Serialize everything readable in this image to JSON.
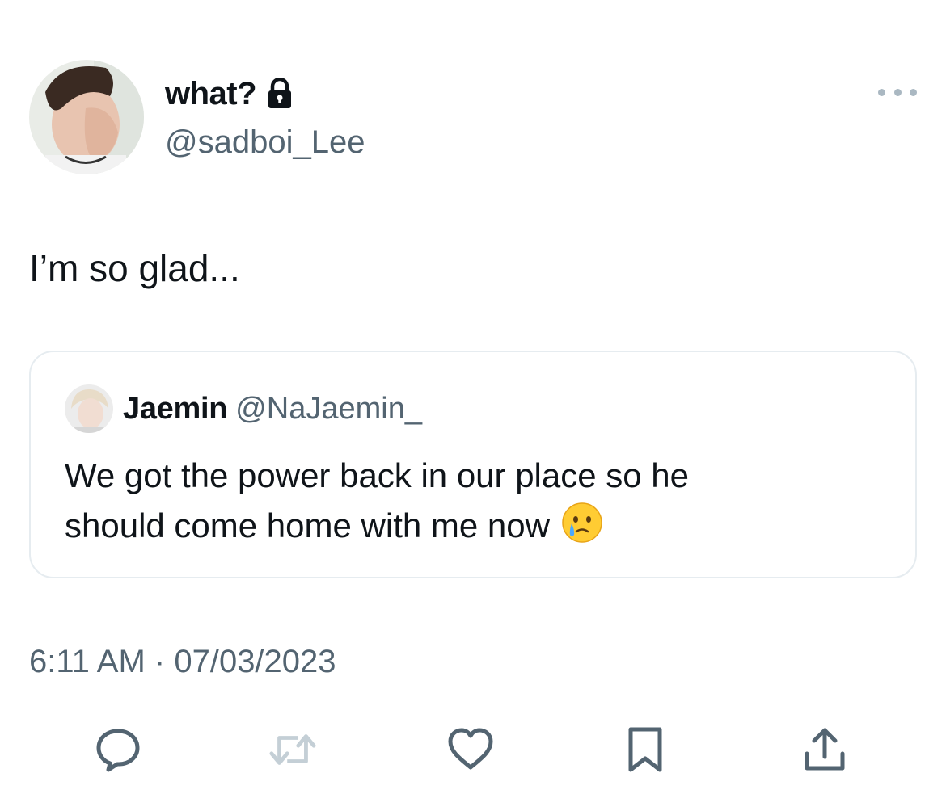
{
  "author": {
    "name": "what?",
    "handle": "@sadboi_Lee",
    "protected_icon": "lock-icon"
  },
  "tweet": {
    "text": "I’m so glad...",
    "timestamp": "6:11 AM · 07/03/2023"
  },
  "quoted_tweet": {
    "name": "Jaemin",
    "handle": "@NaJaemin_",
    "text_line1": "We got the power back in our place so he",
    "text_line2": "should come home with me now",
    "emoji": "face-holding-back-tears"
  },
  "actions": [
    {
      "name": "reply",
      "icon": "reply-icon"
    },
    {
      "name": "retweet",
      "icon": "retweet-icon"
    },
    {
      "name": "like",
      "icon": "heart-icon"
    },
    {
      "name": "bookmark",
      "icon": "bookmark-icon"
    },
    {
      "name": "share",
      "icon": "share-icon"
    }
  ],
  "colors": {
    "text_primary": "#0f1419",
    "text_secondary": "#536471",
    "icon_gray": "#536471",
    "retweet_disabled": "#c4cfd6",
    "border": "#e6ecf0"
  }
}
